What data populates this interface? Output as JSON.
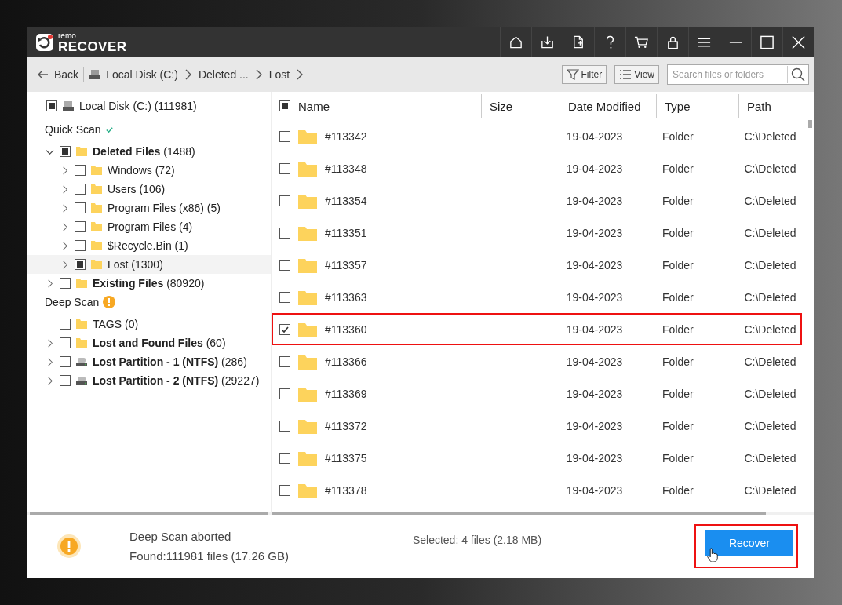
{
  "app": {
    "logo_small": "remo",
    "logo_large": "RECOVER"
  },
  "navigation": {
    "back": "Back",
    "breadcrumbs": [
      {
        "label": "Local Disk (C:)",
        "kind": "drive"
      },
      {
        "label": "Deleted ...",
        "kind": "folder"
      },
      {
        "label": "Lost",
        "kind": "folder"
      }
    ],
    "filter": "Filter",
    "view": "View",
    "search": {
      "placeholder": "Search files or folders"
    }
  },
  "sidebar": {
    "root": {
      "label": "Local Disk (C:) (111981)",
      "checked": false,
      "partial": true
    },
    "sections": [
      {
        "title": "Quick Scan",
        "complete": true,
        "items": [
          {
            "label": "**Deleted Files** (1488)",
            "kind": "folder",
            "expandable": true,
            "expanded": true,
            "checked": false,
            "partial": true,
            "selected": false,
            "children": [
              {
                "label": "Windows (72)",
                "kind": "folder",
                "expandable": true,
                "expanded": false,
                "checked": false,
                "partial": false,
                "selected": false
              },
              {
                "label": "Users (106)",
                "kind": "folder",
                "expandable": true,
                "expanded": false,
                "checked": false,
                "partial": false,
                "selected": false
              },
              {
                "label": "Program Files (x86) (5)",
                "kind": "folder",
                "expandable": true,
                "expanded": false,
                "checked": false,
                "partial": false,
                "selected": false
              },
              {
                "label": "Program Files (4)",
                "kind": "folder",
                "expandable": true,
                "expanded": false,
                "checked": false,
                "partial": false,
                "selected": false
              },
              {
                "label": "$Recycle.Bin (1)",
                "kind": "folder",
                "expandable": true,
                "expanded": false,
                "checked": false,
                "partial": false,
                "selected": false
              },
              {
                "label": "Lost (1300)",
                "kind": "folder",
                "expandable": true,
                "expanded": false,
                "checked": false,
                "partial": true,
                "selected": true
              }
            ]
          },
          {
            "label": "**Existing Files** (80920)",
            "kind": "folder",
            "expandable": true,
            "expanded": false,
            "checked": false,
            "partial": false,
            "selected": false
          }
        ]
      },
      {
        "title": "Deep Scan",
        "complete": false,
        "items": [
          {
            "label": "TAGS (0)",
            "kind": "folder",
            "expandable": false,
            "checked": false,
            "partial": false,
            "selected": false
          },
          {
            "label": "**Lost and Found Files** (60)",
            "kind": "folder",
            "expandable": true,
            "expanded": false,
            "checked": false,
            "partial": false,
            "selected": false
          },
          {
            "label": "**Lost Partition - 1 (NTFS)** (286)",
            "kind": "drive",
            "expandable": true,
            "expanded": false,
            "checked": false,
            "partial": false,
            "selected": false
          },
          {
            "label": "**Lost Partition - 2 (NTFS)** (29227)",
            "kind": "drive",
            "expandable": true,
            "expanded": false,
            "checked": false,
            "partial": false,
            "selected": false
          }
        ]
      }
    ]
  },
  "table": {
    "header_checkbox": {
      "checked": false,
      "partial": true
    },
    "columns": [
      "Name",
      "Size",
      "Date Modified",
      "Type",
      "Path"
    ],
    "rows": [
      {
        "name": "#113342",
        "date": "19-04-2023",
        "type": "Folder",
        "path": "C:\\Deleted",
        "selected": false
      },
      {
        "name": "#113348",
        "date": "19-04-2023",
        "type": "Folder",
        "path": "C:\\Deleted",
        "selected": false
      },
      {
        "name": "#113354",
        "date": "19-04-2023",
        "type": "Folder",
        "path": "C:\\Deleted",
        "selected": false
      },
      {
        "name": "#113351",
        "date": "19-04-2023",
        "type": "Folder",
        "path": "C:\\Deleted",
        "selected": false
      },
      {
        "name": "#113357",
        "date": "19-04-2023",
        "type": "Folder",
        "path": "C:\\Deleted",
        "selected": false
      },
      {
        "name": "#113363",
        "date": "19-04-2023",
        "type": "Folder",
        "path": "C:\\Deleted",
        "selected": false
      },
      {
        "name": "#113360",
        "date": "19-04-2023",
        "type": "Folder",
        "path": "C:\\Deleted",
        "selected": true
      },
      {
        "name": "#113366",
        "date": "19-04-2023",
        "type": "Folder",
        "path": "C:\\Deleted",
        "selected": false
      },
      {
        "name": "#113369",
        "date": "19-04-2023",
        "type": "Folder",
        "path": "C:\\Deleted",
        "selected": false
      },
      {
        "name": "#113372",
        "date": "19-04-2023",
        "type": "Folder",
        "path": "C:\\Deleted",
        "selected": false
      },
      {
        "name": "#113375",
        "date": "19-04-2023",
        "type": "Folder",
        "path": "C:\\Deleted",
        "selected": false
      },
      {
        "name": "#113378",
        "date": "19-04-2023",
        "type": "Folder",
        "path": "C:\\Deleted",
        "selected": false
      }
    ]
  },
  "status_bar": {
    "status": "Deep Scan aborted",
    "found": "Found:111981 files (17.26 GB)",
    "selected_summary": "Selected: 4 files (2.18 MB)",
    "recover": "Recover",
    "recover_highlighted": true
  }
}
